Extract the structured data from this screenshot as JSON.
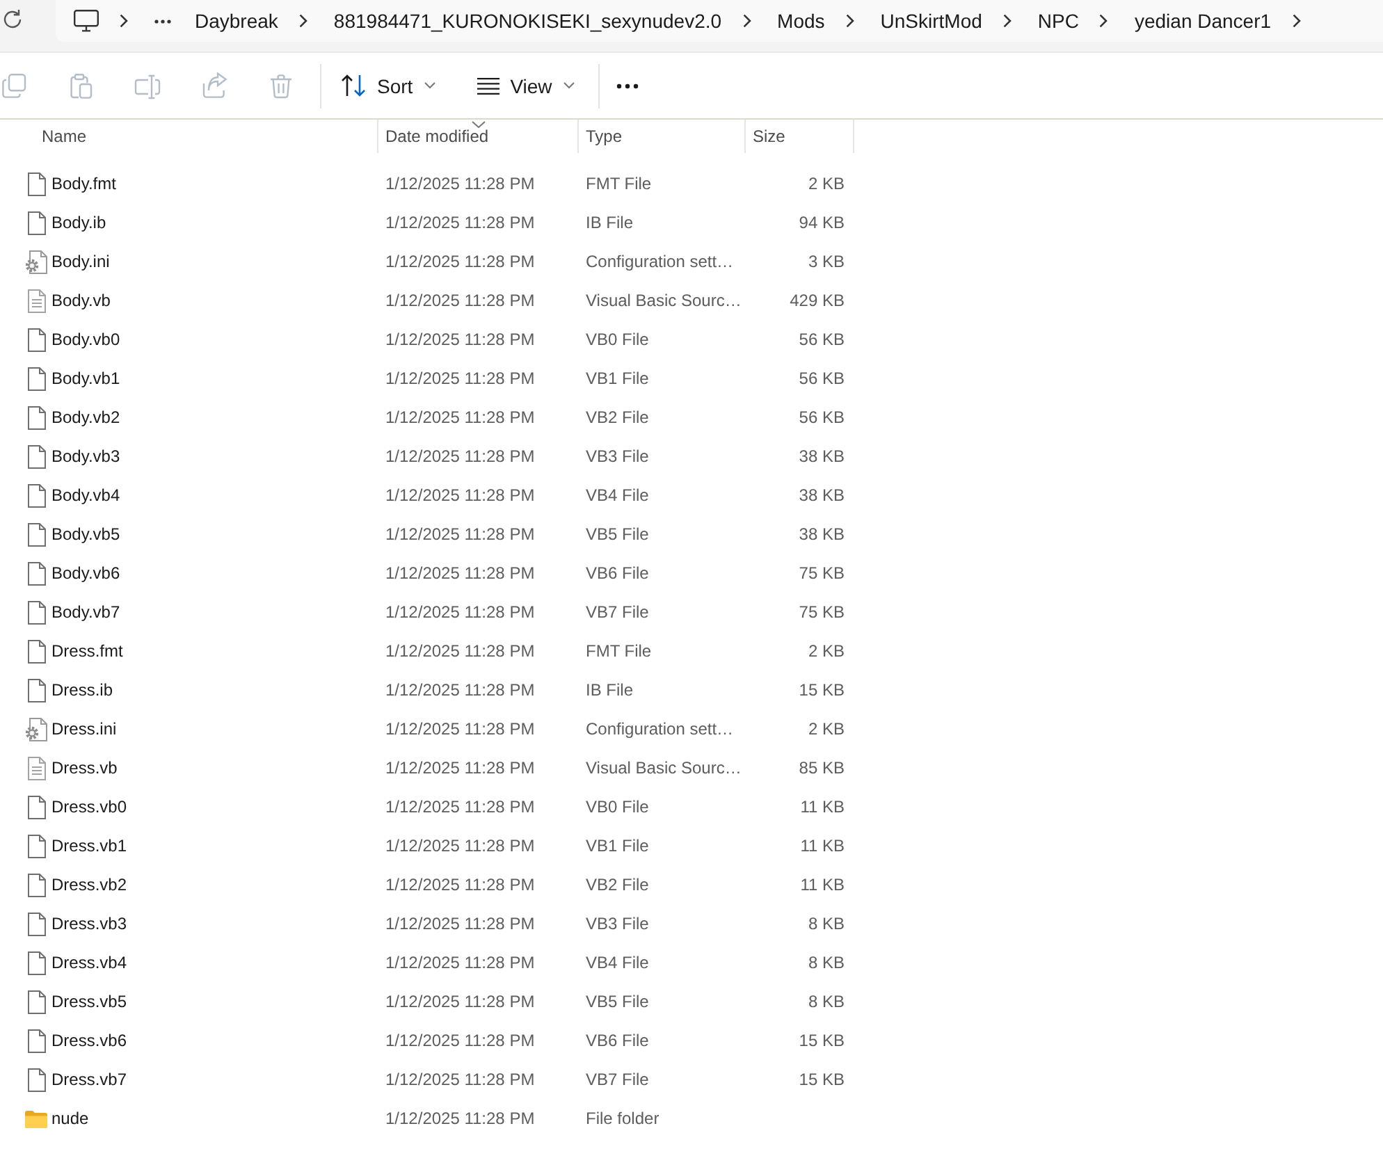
{
  "address_bar": {
    "crumbs": [
      {
        "kind": "computer"
      },
      {
        "kind": "overflow"
      },
      {
        "kind": "folder",
        "label": "Daybreak"
      },
      {
        "kind": "folder",
        "label": "881984471_KURONOKISEKI_sexynudev2.0"
      },
      {
        "kind": "folder",
        "label": "Mods"
      },
      {
        "kind": "folder",
        "label": "UnSkirtMod"
      },
      {
        "kind": "folder",
        "label": "NPC"
      },
      {
        "kind": "folder",
        "label": "yedian Dancer1"
      }
    ]
  },
  "toolbar": {
    "actions": [
      {
        "kind": "copy",
        "disabled": true
      },
      {
        "kind": "paste",
        "disabled": true
      },
      {
        "kind": "rename",
        "disabled": true
      },
      {
        "kind": "share",
        "disabled": true
      },
      {
        "kind": "delete",
        "disabled": true
      }
    ],
    "sort": {
      "label": "Sort"
    },
    "view": {
      "label": "View"
    }
  },
  "files": {
    "columns": [
      {
        "label": "Name",
        "sorted": false
      },
      {
        "label": "Date modified",
        "sorted": true
      },
      {
        "label": "Type",
        "sorted": false
      },
      {
        "label": "Size",
        "sorted": false
      }
    ],
    "rows": [
      {
        "kind": "file",
        "name": "Body.fmt",
        "date_modified": "1/12/2025 11:28 PM",
        "type": "FMT File",
        "size": "2 KB",
        "selected": false
      },
      {
        "kind": "file",
        "name": "Body.ib",
        "date_modified": "1/12/2025 11:28 PM",
        "type": "IB File",
        "size": "94 KB",
        "selected": false
      },
      {
        "kind": "settings",
        "name": "Body.ini",
        "date_modified": "1/12/2025 11:28 PM",
        "type": "Configuration sett…",
        "size": "3 KB",
        "selected": false
      },
      {
        "kind": "text",
        "name": "Body.vb",
        "date_modified": "1/12/2025 11:28 PM",
        "type": "Visual Basic Sourc…",
        "size": "429 KB",
        "selected": false
      },
      {
        "kind": "file",
        "name": "Body.vb0",
        "date_modified": "1/12/2025 11:28 PM",
        "type": "VB0 File",
        "size": "56 KB",
        "selected": false
      },
      {
        "kind": "file",
        "name": "Body.vb1",
        "date_modified": "1/12/2025 11:28 PM",
        "type": "VB1 File",
        "size": "56 KB",
        "selected": false
      },
      {
        "kind": "file",
        "name": "Body.vb2",
        "date_modified": "1/12/2025 11:28 PM",
        "type": "VB2 File",
        "size": "56 KB",
        "selected": false
      },
      {
        "kind": "file",
        "name": "Body.vb3",
        "date_modified": "1/12/2025 11:28 PM",
        "type": "VB3 File",
        "size": "38 KB",
        "selected": false
      },
      {
        "kind": "file",
        "name": "Body.vb4",
        "date_modified": "1/12/2025 11:28 PM",
        "type": "VB4 File",
        "size": "38 KB",
        "selected": false
      },
      {
        "kind": "file",
        "name": "Body.vb5",
        "date_modified": "1/12/2025 11:28 PM",
        "type": "VB5 File",
        "size": "38 KB",
        "selected": false
      },
      {
        "kind": "file",
        "name": "Body.vb6",
        "date_modified": "1/12/2025 11:28 PM",
        "type": "VB6 File",
        "size": "75 KB",
        "selected": false
      },
      {
        "kind": "file",
        "name": "Body.vb7",
        "date_modified": "1/12/2025 11:28 PM",
        "type": "VB7 File",
        "size": "75 KB",
        "selected": false
      },
      {
        "kind": "file",
        "name": "Dress.fmt",
        "date_modified": "1/12/2025 11:28 PM",
        "type": "FMT File",
        "size": "2 KB",
        "selected": false
      },
      {
        "kind": "file",
        "name": "Dress.ib",
        "date_modified": "1/12/2025 11:28 PM",
        "type": "IB File",
        "size": "15 KB",
        "selected": false
      },
      {
        "kind": "settings",
        "name": "Dress.ini",
        "date_modified": "1/12/2025 11:28 PM",
        "type": "Configuration sett…",
        "size": "2 KB",
        "selected": false
      },
      {
        "kind": "text",
        "name": "Dress.vb",
        "date_modified": "1/12/2025 11:28 PM",
        "type": "Visual Basic Sourc…",
        "size": "85 KB",
        "selected": false
      },
      {
        "kind": "file",
        "name": "Dress.vb0",
        "date_modified": "1/12/2025 11:28 PM",
        "type": "VB0 File",
        "size": "11 KB",
        "selected": false
      },
      {
        "kind": "file",
        "name": "Dress.vb1",
        "date_modified": "1/12/2025 11:28 PM",
        "type": "VB1 File",
        "size": "11 KB",
        "selected": false
      },
      {
        "kind": "file",
        "name": "Dress.vb2",
        "date_modified": "1/12/2025 11:28 PM",
        "type": "VB2 File",
        "size": "11 KB",
        "selected": false
      },
      {
        "kind": "file",
        "name": "Dress.vb3",
        "date_modified": "1/12/2025 11:28 PM",
        "type": "VB3 File",
        "size": "8 KB",
        "selected": false
      },
      {
        "kind": "file",
        "name": "Dress.vb4",
        "date_modified": "1/12/2025 11:28 PM",
        "type": "VB4 File",
        "size": "8 KB",
        "selected": false
      },
      {
        "kind": "file",
        "name": "Dress.vb5",
        "date_modified": "1/12/2025 11:28 PM",
        "type": "VB5 File",
        "size": "8 KB",
        "selected": false
      },
      {
        "kind": "file",
        "name": "Dress.vb6",
        "date_modified": "1/12/2025 11:28 PM",
        "type": "VB6 File",
        "size": "15 KB",
        "selected": false
      },
      {
        "kind": "file",
        "name": "Dress.vb7",
        "date_modified": "1/12/2025 11:28 PM",
        "type": "VB7 File",
        "size": "15 KB",
        "selected": false
      },
      {
        "kind": "folder",
        "name": "nude",
        "date_modified": "1/12/2025 11:28 PM",
        "type": "File folder",
        "selected": false
      }
    ]
  }
}
